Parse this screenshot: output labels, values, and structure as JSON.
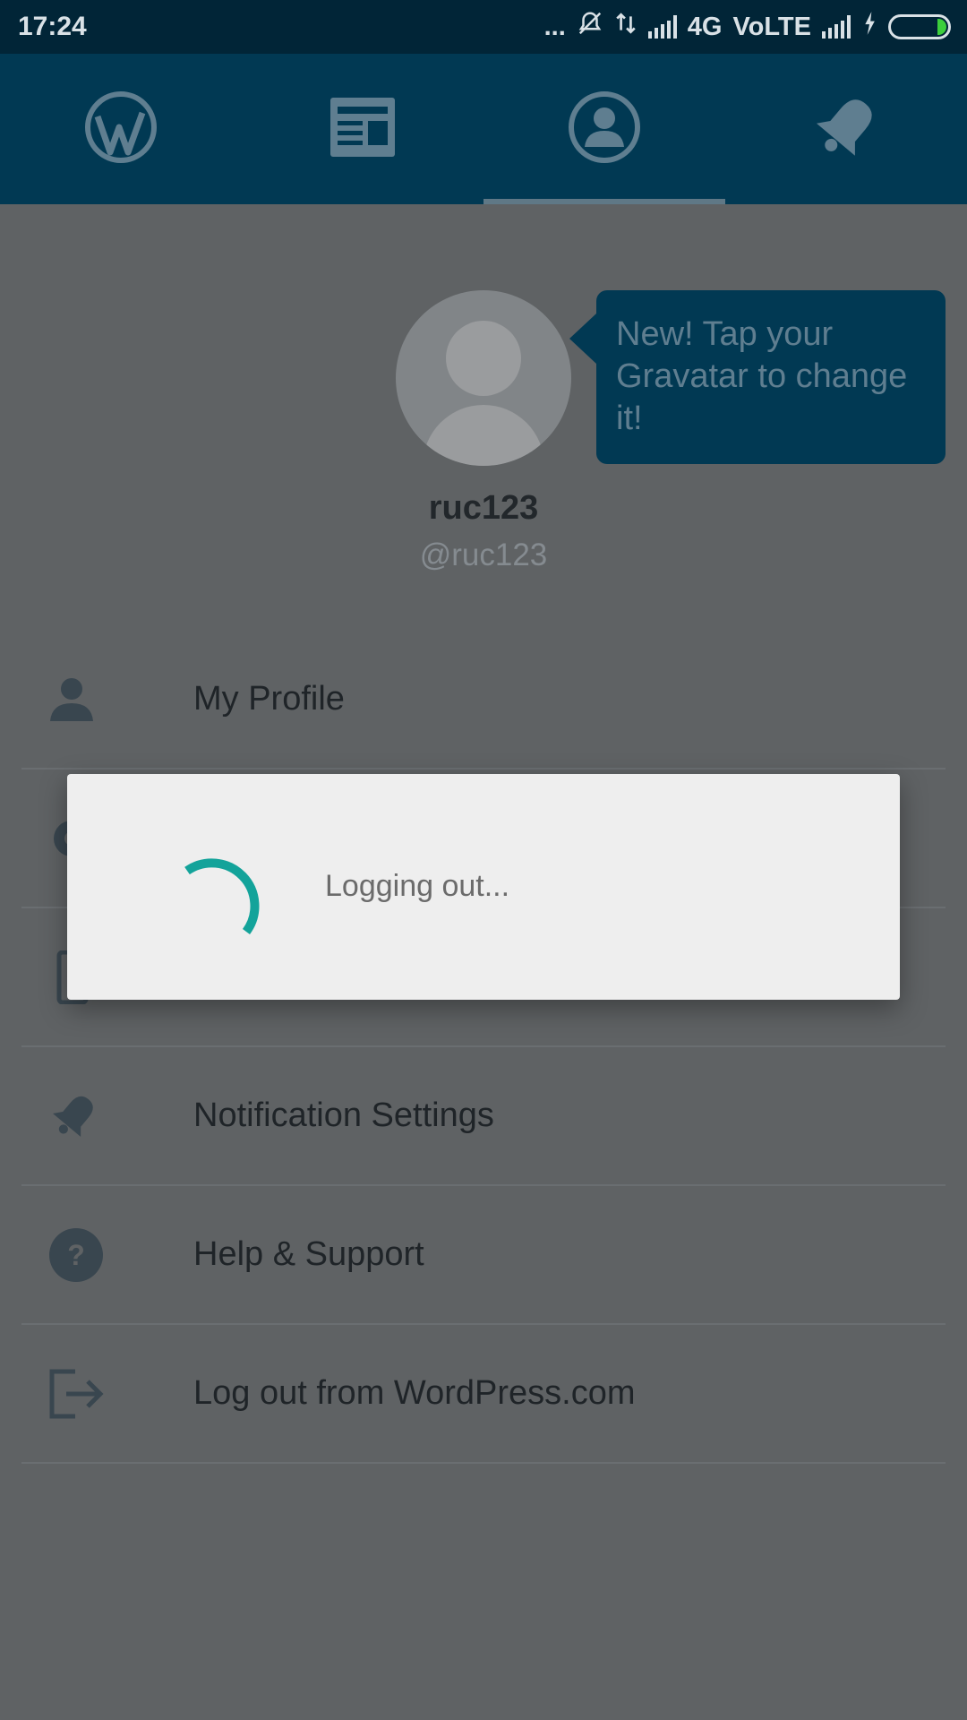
{
  "status_bar": {
    "time": "17:24",
    "dots": "...",
    "network": "4G",
    "volte": "VoLTE"
  },
  "tabs": [
    {
      "name": "wordpress-icon"
    },
    {
      "name": "reader-icon"
    },
    {
      "name": "profile-icon",
      "active": true
    },
    {
      "name": "notifications-icon"
    }
  ],
  "profile": {
    "username": "ruc123",
    "handle": "@ruc123",
    "tooltip": "New! Tap your Gravatar to change it!"
  },
  "menu": {
    "my_profile": "My Profile",
    "notification_settings": "Notification Settings",
    "help_support": "Help & Support",
    "logout": "Log out from WordPress.com"
  },
  "dialog": {
    "message": "Logging out..."
  },
  "colors": {
    "accent": "#13a39a",
    "header": "#013953",
    "status_bar": "#012537"
  }
}
